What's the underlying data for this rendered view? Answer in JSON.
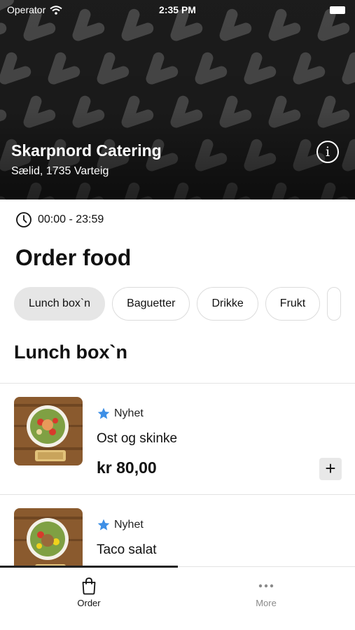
{
  "status_bar": {
    "carrier": "Operator",
    "time": "2:35 PM"
  },
  "venue": {
    "name": "Skarpnord Catering",
    "address": "Sælid, 1735 Varteig"
  },
  "opening_hours": "00:00 - 23:59",
  "page_title": "Order food",
  "category_tabs": [
    {
      "label": "Lunch box`n",
      "active": true
    },
    {
      "label": "Baguetter",
      "active": false
    },
    {
      "label": "Drikke",
      "active": false
    },
    {
      "label": "Frukt",
      "active": false
    }
  ],
  "section_title": "Lunch box`n",
  "products": [
    {
      "badge": "Nyhet",
      "name": "Ost og skinke",
      "price": "kr 80,00",
      "badge_icon": "star-icon"
    },
    {
      "badge": "Nyhet",
      "name": "Taco salat",
      "price": "",
      "badge_icon": "star-icon"
    }
  ],
  "bottom_nav": [
    {
      "label": "Order",
      "icon": "shopping-bag-icon",
      "active": true
    },
    {
      "label": "More",
      "icon": "more-dots-icon",
      "active": false
    }
  ],
  "colors": {
    "accent_star": "#3d8fe6",
    "hero_background": "#1d1d1d",
    "active_tab": "#e6e6e6"
  }
}
